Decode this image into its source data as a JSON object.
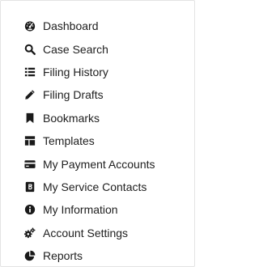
{
  "menu": {
    "items": [
      {
        "label": "Dashboard",
        "icon": "dashboard-gauge-icon"
      },
      {
        "label": "Case Search",
        "icon": "search-icon"
      },
      {
        "label": "Filing History",
        "icon": "list-icon"
      },
      {
        "label": "Filing Drafts",
        "icon": "pencil-icon"
      },
      {
        "label": "Bookmarks",
        "icon": "bookmark-icon"
      },
      {
        "label": "Templates",
        "icon": "templates-icon"
      },
      {
        "label": "My Payment Accounts",
        "icon": "credit-card-icon"
      },
      {
        "label": "My Service Contacts",
        "icon": "contact-card-icon"
      },
      {
        "label": "My Information",
        "icon": "info-circle-icon"
      },
      {
        "label": "Account Settings",
        "icon": "cogs-icon"
      },
      {
        "label": "Reports",
        "icon": "pie-chart-icon"
      }
    ]
  },
  "colors": {
    "text": "#202020",
    "icon": "#1a1a1a",
    "border": "#e3e3e3",
    "background": "#ffffff"
  }
}
